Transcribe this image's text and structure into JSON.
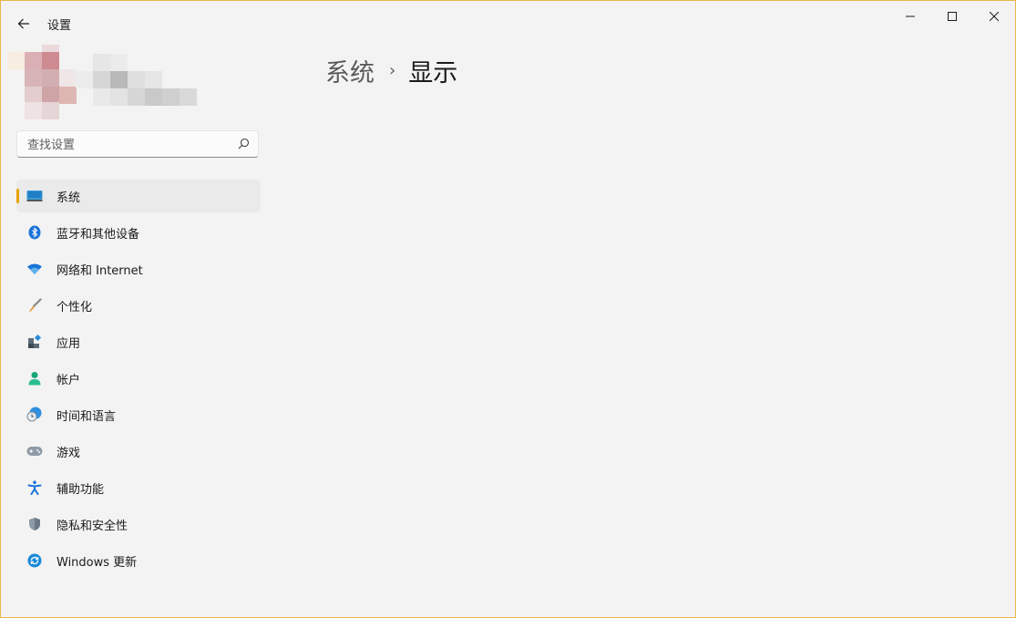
{
  "app": {
    "title": "设置"
  },
  "search": {
    "placeholder": "查找设置"
  },
  "nav": {
    "items": [
      {
        "label": "系统",
        "icon": "display-icon",
        "selected": true
      },
      {
        "label": "蓝牙和其他设备",
        "icon": "bluetooth-icon"
      },
      {
        "label": "网络和 Internet",
        "icon": "wifi-icon"
      },
      {
        "label": "个性化",
        "icon": "brush-icon"
      },
      {
        "label": "应用",
        "icon": "apps-icon"
      },
      {
        "label": "帐户",
        "icon": "account-icon"
      },
      {
        "label": "时间和语言",
        "icon": "time-language-icon"
      },
      {
        "label": "游戏",
        "icon": "gamepad-icon"
      },
      {
        "label": "辅助功能",
        "icon": "accessibility-icon"
      },
      {
        "label": "隐私和安全性",
        "icon": "shield-icon"
      },
      {
        "label": "Windows 更新",
        "icon": "update-icon"
      }
    ]
  },
  "breadcrumb": {
    "parent": "系统",
    "separator": "›",
    "current": "显示"
  },
  "colors": {
    "accent": "#e8a200",
    "window_border": "#e8b84a",
    "background": "#f3f3f3"
  }
}
